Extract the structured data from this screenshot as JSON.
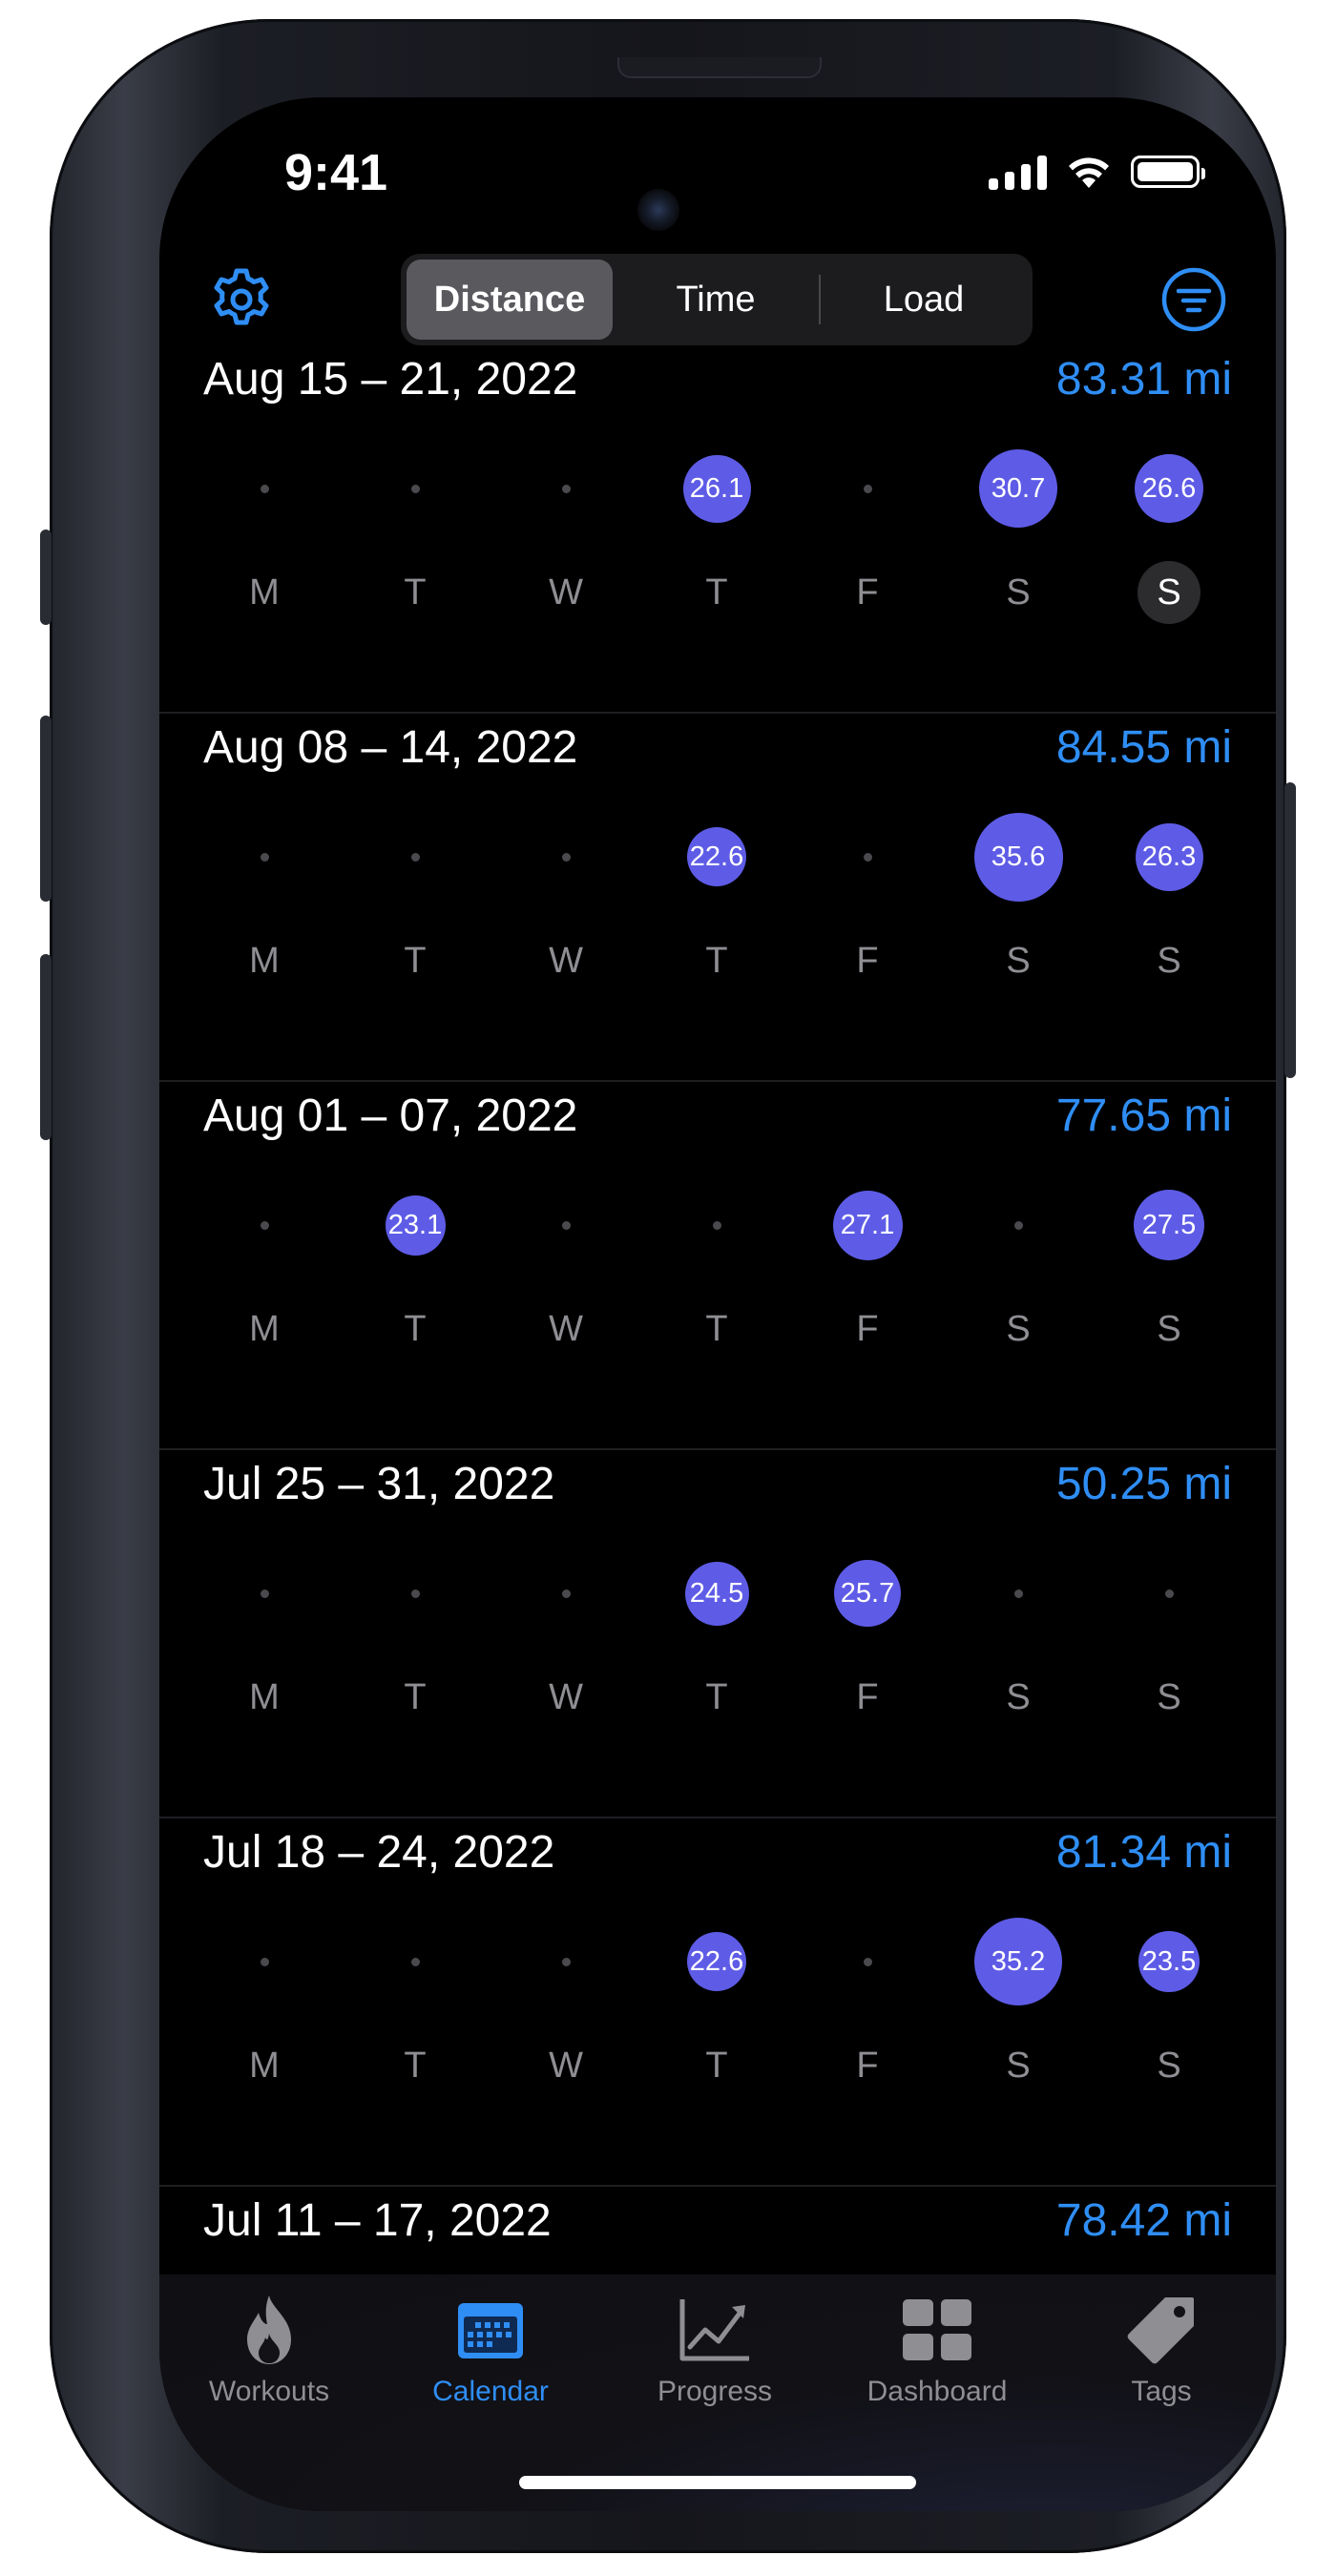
{
  "status_bar": {
    "time": "9:41"
  },
  "top_bar": {
    "segments": [
      {
        "label": "Distance",
        "active": true
      },
      {
        "label": "Time",
        "active": false
      },
      {
        "label": "Load",
        "active": false
      }
    ],
    "left_icon": "gear-icon",
    "right_icon": "filter-icon",
    "accent_color": "#2f8ef5"
  },
  "day_labels": [
    "M",
    "T",
    "W",
    "T",
    "F",
    "S",
    "S"
  ],
  "bubble_color": "#5e5ce6",
  "weeks": [
    {
      "title": "Aug 15 – 21, 2022",
      "total": "83.31 mi",
      "days": [
        null,
        null,
        null,
        "26.1",
        null,
        "30.7",
        "26.6"
      ],
      "today_index": 6
    },
    {
      "title": "Aug 08 – 14, 2022",
      "total": "84.55 mi",
      "days": [
        null,
        null,
        null,
        "22.6",
        null,
        "35.6",
        "26.3"
      ]
    },
    {
      "title": "Aug 01 – 07, 2022",
      "total": "77.65 mi",
      "days": [
        null,
        "23.1",
        null,
        null,
        "27.1",
        null,
        "27.5"
      ]
    },
    {
      "title": "Jul 25 – 31, 2022",
      "total": "50.25 mi",
      "days": [
        null,
        null,
        null,
        "24.5",
        "25.7",
        null,
        null
      ]
    },
    {
      "title": "Jul 18 – 24, 2022",
      "total": "81.34 mi",
      "days": [
        null,
        null,
        null,
        "22.6",
        null,
        "35.2",
        "23.5"
      ]
    },
    {
      "title": "Jul 11 – 17, 2022",
      "total": "78.42 mi",
      "days": []
    }
  ],
  "tab_bar": {
    "tabs": [
      {
        "label": "Workouts",
        "icon": "flame-icon",
        "active": false
      },
      {
        "label": "Calendar",
        "icon": "calendar-icon",
        "active": true
      },
      {
        "label": "Progress",
        "icon": "chart-icon",
        "active": false
      },
      {
        "label": "Dashboard",
        "icon": "dashboard-icon",
        "active": false
      },
      {
        "label": "Tags",
        "icon": "tag-icon",
        "active": false
      }
    ]
  }
}
